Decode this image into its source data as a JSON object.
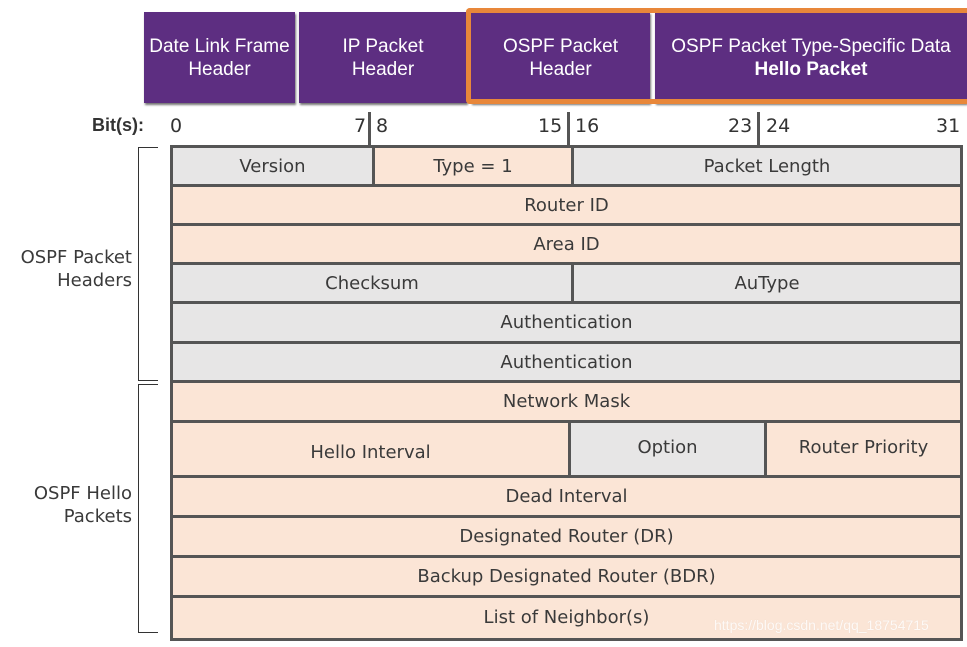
{
  "headers": [
    {
      "label": "Date Link Frame Header"
    },
    {
      "label": "IP Packet Header"
    },
    {
      "label": "OSPF Packet Header"
    },
    {
      "label": "OSPF Packet Type-Specific Data",
      "sublabel": "Hello Packet"
    }
  ],
  "highlight_color": "#e8873a",
  "header_color": "#5d2e81",
  "bits": {
    "label": "Bit(s):",
    "ticks": [
      "0",
      "7",
      "8",
      "15",
      "16",
      "23",
      "24",
      "31"
    ]
  },
  "sections": [
    {
      "label": "OSPF Packet Headers"
    },
    {
      "label": "OSPF Hello Packets"
    }
  ],
  "fields": {
    "version": "Version",
    "type": "Type = 1",
    "packet_length": "Packet Length",
    "router_id": "Router ID",
    "area_id": "Area ID",
    "checksum": "Checksum",
    "autype": "AuType",
    "authentication_1": "Authentication",
    "authentication_2": "Authentication",
    "network_mask": "Network Mask",
    "hello_interval": "Hello Interval",
    "option": "Option",
    "router_priority": "Router Priority",
    "dead_interval": "Dead Interval",
    "dr": "Designated Router (DR)",
    "bdr": "Backup Designated Router (BDR)",
    "neighbors": "List of Neighbor(s)"
  },
  "colors": {
    "peach": "#fbe5d6",
    "gray": "#e7e6e6"
  },
  "watermark": "https://blog.csdn.net/qq_18754715"
}
